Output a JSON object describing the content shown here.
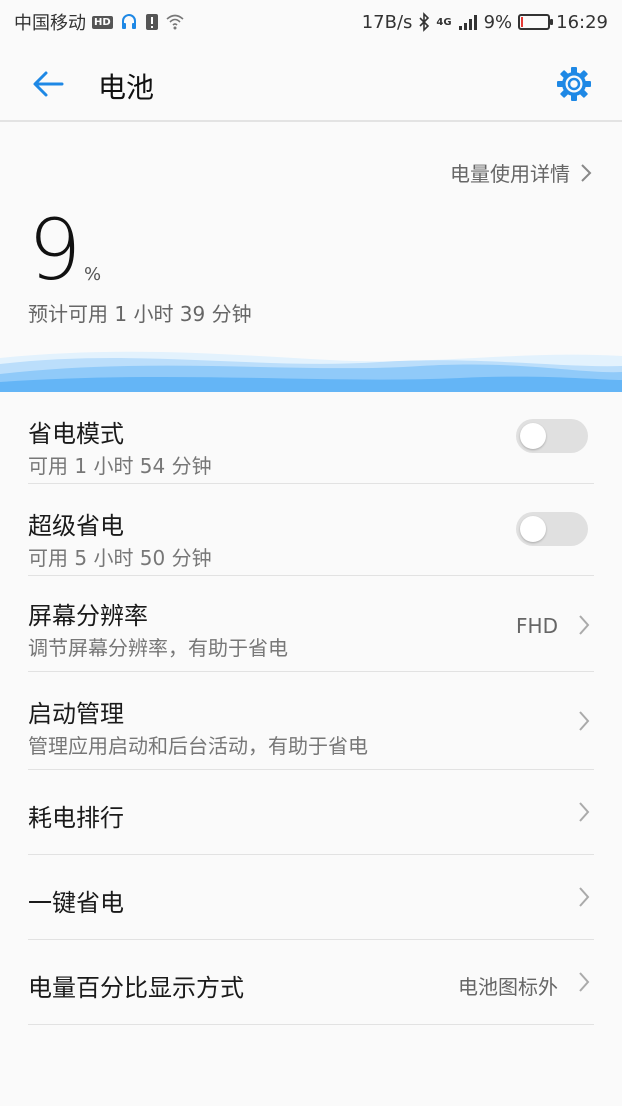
{
  "status": {
    "carrier": "中国移动",
    "hd": "HD",
    "speed": "17B/s",
    "net": "4G",
    "battery_pct": "9%",
    "time": "16:29",
    "battery_level": 0.09
  },
  "header": {
    "title": "电池"
  },
  "detail_link": "电量使用详情",
  "battery": {
    "percent": "9",
    "unit": "%",
    "estimate": "预计可用 1 小时 39 分钟"
  },
  "rows": [
    {
      "title": "省电模式",
      "sub": "可用 1 小时 54 分钟",
      "toggle": false
    },
    {
      "title": "超级省电",
      "sub": "可用 5 小时 50 分钟",
      "toggle": false
    },
    {
      "title": "屏幕分辨率",
      "sub": "调节屏幕分辨率，有助于省电",
      "value": "FHD"
    },
    {
      "title": "启动管理",
      "sub": "管理应用启动和后台活动，有助于省电"
    },
    {
      "title": "耗电排行"
    },
    {
      "title": "一键省电"
    },
    {
      "title": "电量百分比显示方式",
      "value": "电池图标外"
    }
  ],
  "colors": {
    "accent": "#1e88e5",
    "wave": "#64b5f6"
  }
}
